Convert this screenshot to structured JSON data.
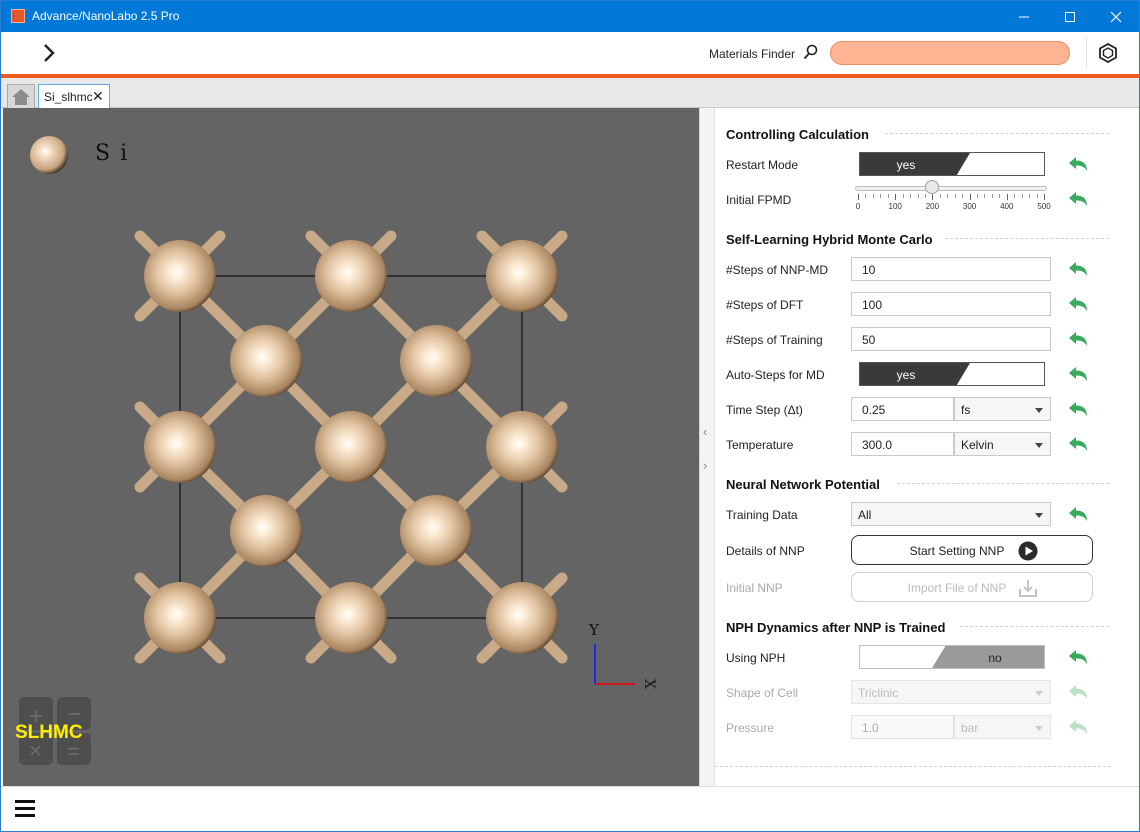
{
  "window": {
    "title": "Advance/NanoLabo 2.5 Pro"
  },
  "toolbar": {
    "finder_label": "Materials Finder",
    "finder_value": ""
  },
  "tabs": {
    "file_tab": "Si_slhmc",
    "close_glyph": "✕"
  },
  "viewer": {
    "legend_element": "Si",
    "axis_y": "Y",
    "axis_x": "X",
    "badge": "SLHMC",
    "atom_color": "#d8b898"
  },
  "panel": {
    "controlling": {
      "title": "Controlling Calculation",
      "restart_label": "Restart Mode",
      "restart_value": "yes",
      "fpmd_label": "Initial FPMD",
      "fpmd_value": 200,
      "fpmd_ticks": [
        "0",
        "100",
        "200",
        "300",
        "400",
        "500"
      ]
    },
    "slhmc": {
      "title": "Self-Learning Hybrid Monte Carlo",
      "nnp_md_label": "#Steps of NNP-MD",
      "nnp_md_value": "10",
      "dft_label": "#Steps of DFT",
      "dft_value": "100",
      "training_label": "#Steps of Training",
      "training_value": "50",
      "auto_label": "Auto-Steps for MD",
      "auto_value": "yes",
      "timestep_label": "Time Step (Δt)",
      "timestep_value": "0.25",
      "timestep_unit": "fs",
      "temp_label": "Temperature",
      "temp_value": "300.0",
      "temp_unit": "Kelvin"
    },
    "nnp": {
      "title": "Neural Network Potential",
      "training_data_label": "Training Data",
      "training_data_value": "All",
      "details_label": "Details of NNP",
      "details_button": "Start Setting NNP",
      "initial_label": "Initial NNP",
      "initial_button": "Import File of NNP"
    },
    "nph": {
      "title": "NPH Dynamics after NNP is Trained",
      "using_label": "Using NPH",
      "using_value": "no",
      "shape_label": "Shape of Cell",
      "shape_value": "Triclinic",
      "pressure_label": "Pressure",
      "pressure_value": "1.0",
      "pressure_unit": "bar"
    }
  },
  "colors": {
    "titlebar": "#0078d7",
    "accent_orange": "#f05a1e",
    "finder_fill": "#ffb494",
    "reset_green": "#3aaa5e",
    "viewer_bg": "#646464"
  }
}
